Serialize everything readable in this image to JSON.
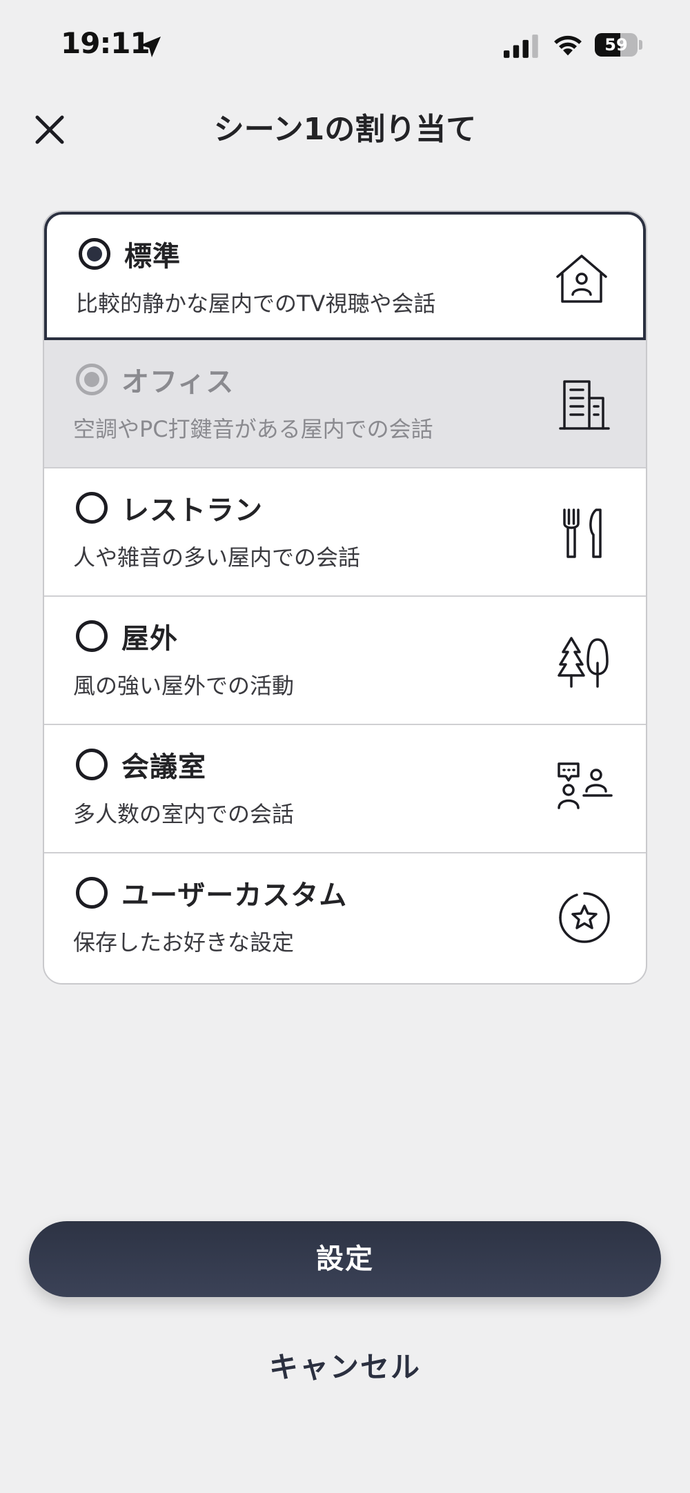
{
  "status_bar": {
    "time": "19:11",
    "battery": "59",
    "battery_level": 0.59
  },
  "header": {
    "title": "シーン1の割り当て"
  },
  "options": [
    {
      "title": "標準",
      "description": "比較的静かな屋内でのTV視聴や会話",
      "icon": "house-person-icon",
      "state": "selected"
    },
    {
      "title": "オフィス",
      "description": "空調やPC打鍵音がある屋内での会話",
      "icon": "office-building-icon",
      "state": "disabled"
    },
    {
      "title": "レストラン",
      "description": "人や雑音の多い屋内での会話",
      "icon": "fork-knife-icon",
      "state": "unselected"
    },
    {
      "title": "屋外",
      "description": "風の強い屋外での活動",
      "icon": "trees-icon",
      "state": "unselected"
    },
    {
      "title": "会議室",
      "description": "多人数の室内での会話",
      "icon": "meeting-people-icon",
      "state": "unselected"
    },
    {
      "title": "ユーザーカスタム",
      "description": "保存したお好きな設定",
      "icon": "star-circle-icon",
      "state": "unselected"
    }
  ],
  "buttons": {
    "confirm": "設定",
    "cancel": "キャンセル"
  },
  "colors": {
    "background": "#efeff0",
    "accent": "#2b3040",
    "disabled_row": "#e3e3e6"
  }
}
